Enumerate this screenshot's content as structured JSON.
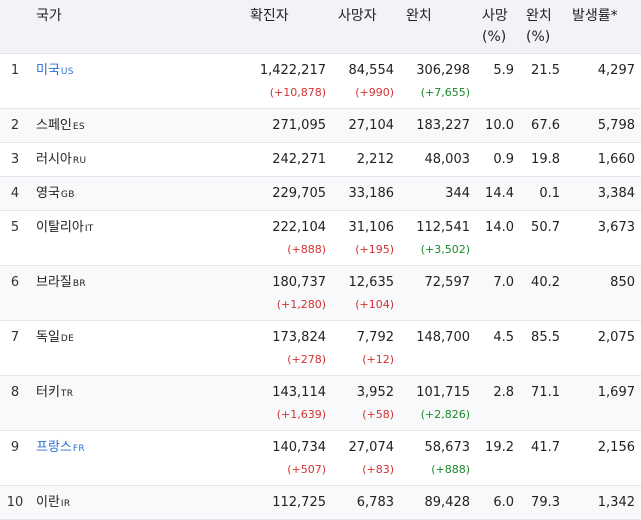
{
  "headers": {
    "rank": "",
    "country": "국가",
    "confirmed": "확진자",
    "deaths": "사망자",
    "recovered": "완치",
    "death_rate_line1": "사망",
    "death_rate_line2": "(%)",
    "recovery_rate_line1": "완치",
    "recovery_rate_line2": "(%)",
    "incidence": "발생률*"
  },
  "colors": {
    "link": "#2b6fd3",
    "increase_red": "#d33232",
    "increase_green": "#1a8a2a",
    "header_bg": "#f1f3f6"
  },
  "rows": [
    {
      "rank": "1",
      "name": "미국",
      "code": "US",
      "link": true,
      "confirmed": "1,422,217",
      "confirmed_delta": "(+10,878)",
      "deaths": "84,554",
      "deaths_delta": "(+990)",
      "recovered": "306,298",
      "recovered_delta": "(+7,655)",
      "death_rate": "5.9",
      "recovery_rate": "21.5",
      "incidence": "4,297"
    },
    {
      "rank": "2",
      "name": "스페인",
      "code": "ES",
      "link": false,
      "confirmed": "271,095",
      "confirmed_delta": "",
      "deaths": "27,104",
      "deaths_delta": "",
      "recovered": "183,227",
      "recovered_delta": "",
      "death_rate": "10.0",
      "recovery_rate": "67.6",
      "incidence": "5,798"
    },
    {
      "rank": "3",
      "name": "러시아",
      "code": "RU",
      "link": false,
      "confirmed": "242,271",
      "confirmed_delta": "",
      "deaths": "2,212",
      "deaths_delta": "",
      "recovered": "48,003",
      "recovered_delta": "",
      "death_rate": "0.9",
      "recovery_rate": "19.8",
      "incidence": "1,660"
    },
    {
      "rank": "4",
      "name": "영국",
      "code": "GB",
      "link": false,
      "confirmed": "229,705",
      "confirmed_delta": "",
      "deaths": "33,186",
      "deaths_delta": "",
      "recovered": "344",
      "recovered_delta": "",
      "death_rate": "14.4",
      "recovery_rate": "0.1",
      "incidence": "3,384"
    },
    {
      "rank": "5",
      "name": "이탈리아",
      "code": "IT",
      "link": false,
      "confirmed": "222,104",
      "confirmed_delta": "(+888)",
      "deaths": "31,106",
      "deaths_delta": "(+195)",
      "recovered": "112,541",
      "recovered_delta": "(+3,502)",
      "death_rate": "14.0",
      "recovery_rate": "50.7",
      "incidence": "3,673"
    },
    {
      "rank": "6",
      "name": "브라질",
      "code": "BR",
      "link": false,
      "confirmed": "180,737",
      "confirmed_delta": "(+1,280)",
      "deaths": "12,635",
      "deaths_delta": "(+104)",
      "recovered": "72,597",
      "recovered_delta": "",
      "death_rate": "7.0",
      "recovery_rate": "40.2",
      "incidence": "850"
    },
    {
      "rank": "7",
      "name": "독일",
      "code": "DE",
      "link": false,
      "confirmed": "173,824",
      "confirmed_delta": "(+278)",
      "deaths": "7,792",
      "deaths_delta": "(+12)",
      "recovered": "148,700",
      "recovered_delta": "",
      "death_rate": "4.5",
      "recovery_rate": "85.5",
      "incidence": "2,075"
    },
    {
      "rank": "8",
      "name": "터키",
      "code": "TR",
      "link": false,
      "confirmed": "143,114",
      "confirmed_delta": "(+1,639)",
      "deaths": "3,952",
      "deaths_delta": "(+58)",
      "recovered": "101,715",
      "recovered_delta": "(+2,826)",
      "death_rate": "2.8",
      "recovery_rate": "71.1",
      "incidence": "1,697"
    },
    {
      "rank": "9",
      "name": "프랑스",
      "code": "FR",
      "link": true,
      "confirmed": "140,734",
      "confirmed_delta": "(+507)",
      "deaths": "27,074",
      "deaths_delta": "(+83)",
      "recovered": "58,673",
      "recovered_delta": "(+888)",
      "death_rate": "19.2",
      "recovery_rate": "41.7",
      "incidence": "2,156"
    },
    {
      "rank": "10",
      "name": "이란",
      "code": "IR",
      "link": false,
      "confirmed": "112,725",
      "confirmed_delta": "",
      "deaths": "6,783",
      "deaths_delta": "",
      "recovered": "89,428",
      "recovered_delta": "",
      "death_rate": "6.0",
      "recovery_rate": "79.3",
      "incidence": "1,342"
    }
  ]
}
